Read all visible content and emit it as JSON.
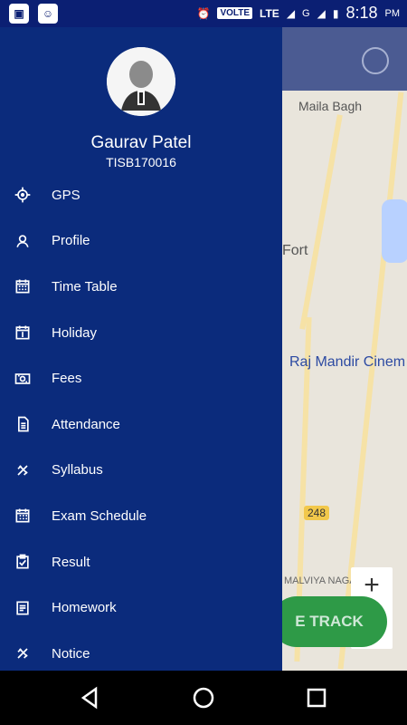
{
  "status_bar": {
    "left_icons": [
      "app-icon-1",
      "android-icon"
    ],
    "volte": "VOLTE",
    "lte": "LTE",
    "g": "G",
    "time": "8:18",
    "ampm": "PM"
  },
  "map": {
    "labels": [
      "Maila Bagh",
      "Fort",
      "Raj Mandir Cinem",
      "248",
      "MALVIYA NAGAR"
    ],
    "track_button": "E TRACK",
    "zoom_in": "+"
  },
  "drawer": {
    "user": {
      "name": "Gaurav Patel",
      "id": "TISB170016"
    },
    "menu": [
      {
        "label": "GPS",
        "icon": "gps-icon"
      },
      {
        "label": "Profile",
        "icon": "profile-icon"
      },
      {
        "label": "Time Table",
        "icon": "calendar-icon"
      },
      {
        "label": "Holiday",
        "icon": "holiday-icon"
      },
      {
        "label": "Fees",
        "icon": "fees-icon"
      },
      {
        "label": "Attendance",
        "icon": "attendance-icon"
      },
      {
        "label": "Syllabus",
        "icon": "syllabus-icon"
      },
      {
        "label": "Exam Schedule",
        "icon": "exam-schedule-icon"
      },
      {
        "label": "Result",
        "icon": "result-icon"
      },
      {
        "label": "Homework",
        "icon": "homework-icon"
      },
      {
        "label": "Notice",
        "icon": "notice-icon"
      }
    ]
  }
}
